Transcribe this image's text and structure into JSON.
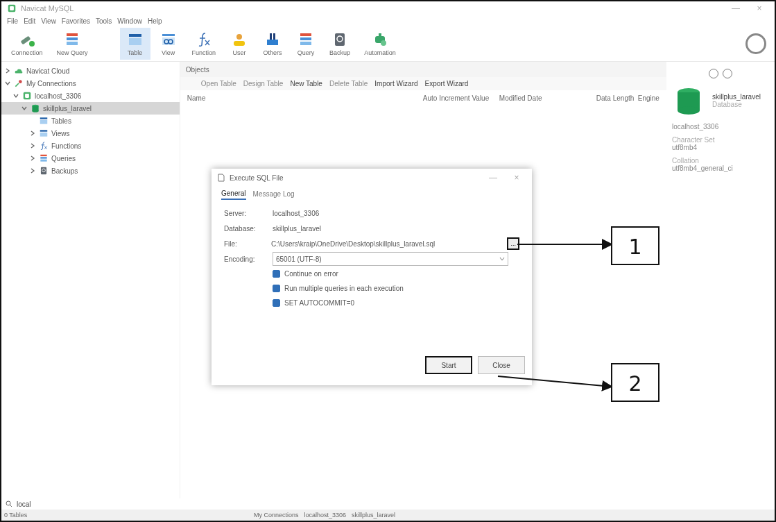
{
  "window": {
    "title": "Navicat MySQL",
    "controls": [
      "—",
      "×"
    ]
  },
  "menu": [
    "File",
    "Edit",
    "View",
    "Favorites",
    "Tools",
    "Window",
    "Help"
  ],
  "toolbar": [
    {
      "label": "Connection",
      "selected": false
    },
    {
      "label": "New Query",
      "selected": false
    },
    {
      "label": "Table",
      "selected": true
    },
    {
      "label": "View",
      "selected": false
    },
    {
      "label": "Function",
      "selected": false
    },
    {
      "label": "User",
      "selected": false
    },
    {
      "label": "Others",
      "selected": false
    },
    {
      "label": "Query",
      "selected": false
    },
    {
      "label": "Backup",
      "selected": false
    },
    {
      "label": "Automation",
      "selected": false
    }
  ],
  "sidebar": {
    "tree": [
      {
        "label": "Navicat Cloud",
        "expanded": false,
        "selected": false
      },
      {
        "label": "My Connections",
        "expanded": true,
        "selected": false,
        "children": [
          {
            "label": "localhost_3306",
            "expanded": true,
            "selected": false,
            "children": [
              {
                "label": "skillplus_laravel",
                "expanded": true,
                "selected": true,
                "children": [
                  {
                    "label": "Tables",
                    "selected": false
                  },
                  {
                    "label": "Views",
                    "expanded": false,
                    "selected": false
                  },
                  {
                    "label": "Functions",
                    "expanded": false,
                    "selected": false
                  },
                  {
                    "label": "Queries",
                    "expanded": false,
                    "selected": false
                  },
                  {
                    "label": "Backups",
                    "expanded": false,
                    "selected": false
                  }
                ]
              }
            ]
          }
        ]
      }
    ],
    "search": {
      "value": "local"
    }
  },
  "objects": {
    "tab": "Objects",
    "actions": [
      {
        "label": "Open Table",
        "disabled": true
      },
      {
        "label": "Design Table",
        "disabled": true
      },
      {
        "label": "New Table",
        "disabled": false
      },
      {
        "label": "Delete Table",
        "disabled": true
      },
      {
        "label": "Import Wizard",
        "disabled": false
      },
      {
        "label": "Export Wizard",
        "disabled": false
      }
    ],
    "columns": [
      "Name",
      "Auto Increment Value",
      "Modified Date",
      "Data Length",
      "Engine"
    ]
  },
  "info_panel": {
    "name": "skillplus_laravel",
    "subtitle": "Database",
    "connection": "localhost_3306",
    "fields": [
      {
        "label": "Character Set",
        "value": "utf8mb4"
      },
      {
        "label": "Collation",
        "value": "utf8mb4_general_ci"
      }
    ]
  },
  "status_bar": {
    "count": "0 Tables",
    "path": [
      "My Connections",
      "localhost_3306",
      "skillplus_laravel"
    ]
  },
  "dialog": {
    "title": "Execute SQL File",
    "controls": [
      "—",
      "×"
    ],
    "tabs": [
      {
        "label": "General",
        "selected": true
      },
      {
        "label": "Message Log",
        "selected": false
      }
    ],
    "fields": [
      {
        "kind": "text",
        "label": "Server:",
        "value": "localhost_3306"
      },
      {
        "kind": "text",
        "label": "Database:",
        "value": "skillplus_laravel"
      },
      {
        "kind": "file",
        "label": "File:",
        "value": "C:\\Users\\kraip\\OneDrive\\Desktop\\skillplus_laravel.sql",
        "button": "..."
      },
      {
        "kind": "select",
        "label": "Encoding:",
        "value": "65001 (UTF-8)"
      }
    ],
    "options": [
      {
        "label": "Continue on error",
        "checked": true
      },
      {
        "label": "Run multiple queries in each execution",
        "checked": true
      },
      {
        "label": "SET AUTOCOMMIT=0",
        "checked": true
      }
    ],
    "buttons": [
      {
        "label": "Start",
        "highlighted": true
      },
      {
        "label": "Close",
        "highlighted": false
      }
    ]
  },
  "callouts": [
    {
      "number": "1"
    },
    {
      "number": "2"
    }
  ]
}
